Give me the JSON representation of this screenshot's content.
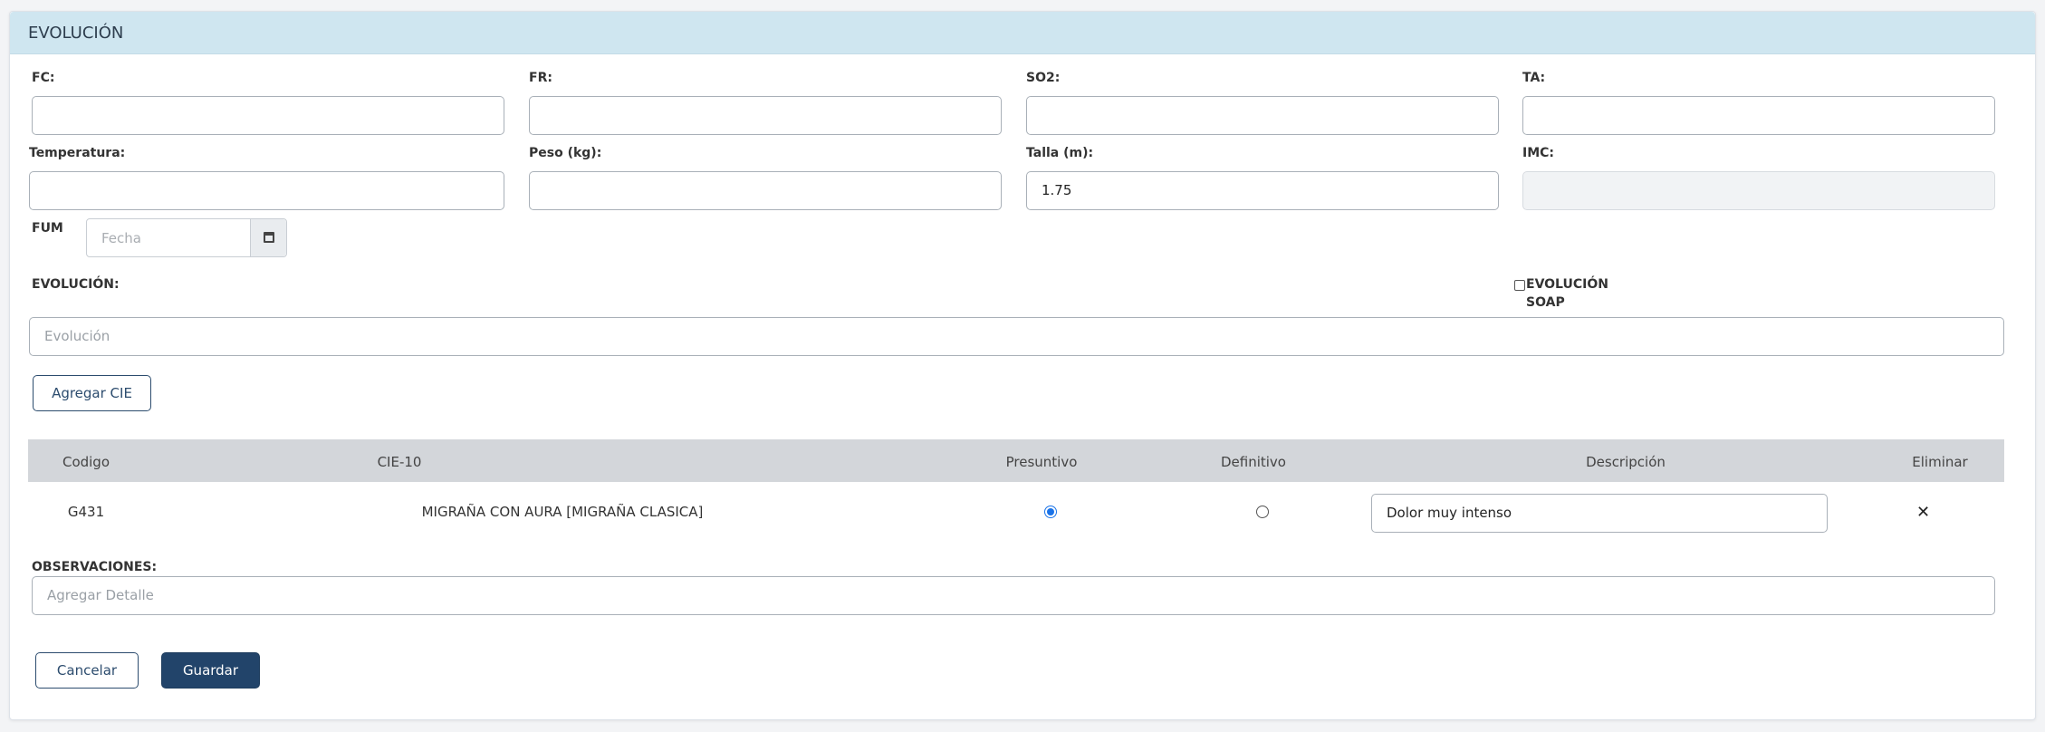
{
  "header": {
    "title": "EVOLUCIÓN"
  },
  "vitals": {
    "fc": {
      "label": "FC:",
      "value": ""
    },
    "fr": {
      "label": "FR:",
      "value": ""
    },
    "so2": {
      "label": "SO2:",
      "value": ""
    },
    "ta": {
      "label": "TA:",
      "value": ""
    },
    "temperatura": {
      "label": "Temperatura:",
      "value": ""
    },
    "peso": {
      "label": "Peso (kg):",
      "value": ""
    },
    "talla": {
      "label": "Talla (m):",
      "value": "1.75"
    },
    "imc": {
      "label": "IMC:",
      "value": ""
    }
  },
  "fum": {
    "label": "FUM",
    "placeholder": "Fecha",
    "icon": "calendar-icon"
  },
  "evolucion": {
    "label": "EVOLUCIÓN:",
    "placeholder": "Evolución",
    "soap_label_line1": "EVOLUCIÓN",
    "soap_label_line2": "SOAP",
    "soap_checked": false
  },
  "buttons": {
    "agregar_cie": "Agregar CIE",
    "cancelar": "Cancelar",
    "guardar": "Guardar"
  },
  "cie_table": {
    "columns": [
      "Codigo",
      "CIE-10",
      "Presuntivo",
      "Definitivo",
      "Descripción",
      "Eliminar"
    ],
    "rows": [
      {
        "codigo": "G431",
        "cie10": "MIGRAÑA CON AURA [MIGRAÑA CLASICA]",
        "presuntivo": true,
        "definitivo": false,
        "descripcion": "Dolor muy intenso",
        "eliminar_icon": "close-icon"
      }
    ]
  },
  "observaciones": {
    "label": "OBSERVACIONES:",
    "placeholder": "Agregar Detalle"
  },
  "colors": {
    "header_bg": "#cfe6f0",
    "primary": "#22446a",
    "radio_accent": "#1a73e8"
  }
}
